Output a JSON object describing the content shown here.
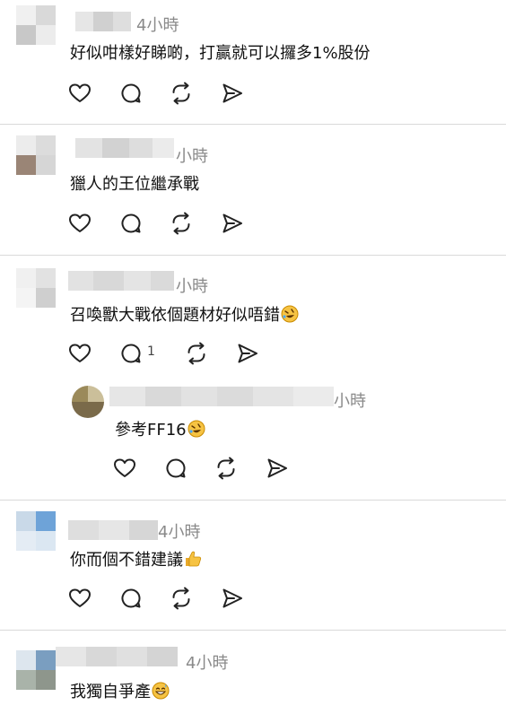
{
  "comments": [
    {
      "time": "4小時",
      "text": "好似咁樣好睇啲，打贏就可以攞多1%股份",
      "emoji": ""
    },
    {
      "time": "小時",
      "text": "獵人的王位繼承戰",
      "emoji": ""
    },
    {
      "time": "小時",
      "text": "召喚獸大戰依個題材好似唔錯",
      "emoji": "rofl-emoji",
      "reply_count": "1"
    },
    {
      "time": "小時",
      "text": "參考FF16",
      "emoji": "rofl-emoji"
    },
    {
      "time": "4小時",
      "text": "你而個不錯建議",
      "emoji": "thumbs-up-emoji"
    },
    {
      "time": "4小時",
      "text": "我獨自爭產",
      "emoji": "grinning-sweat-emoji"
    }
  ],
  "icons": {
    "like": "heart-icon",
    "reply": "speech-bubble-icon",
    "repost": "repost-icon",
    "share": "send-icon"
  },
  "colors": {
    "divider": "#d9d9d9",
    "timestamp": "#8a8a8a",
    "text": "#111111",
    "emoji": "#f6c343"
  }
}
